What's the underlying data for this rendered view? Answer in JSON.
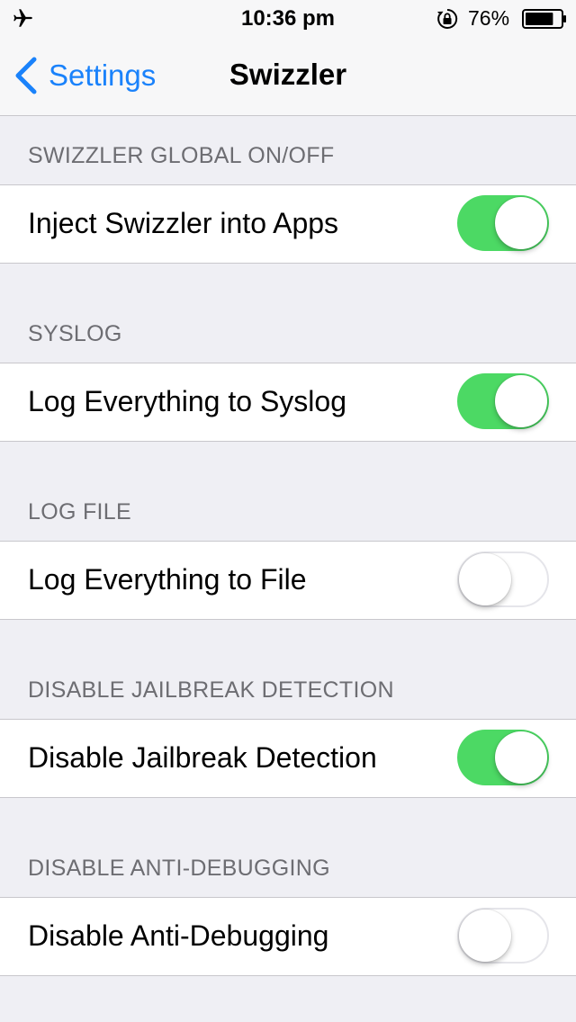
{
  "status_bar": {
    "time": "10:36 pm",
    "battery_percent": "76%",
    "battery_level": 0.76,
    "icons": [
      "airplane-icon",
      "orientation-lock-icon",
      "battery-icon"
    ]
  },
  "nav": {
    "back_label": "Settings",
    "title": "Swizzler",
    "accent_color": "#1a82fb"
  },
  "sections": [
    {
      "header": "SWIZZLER GLOBAL ON/OFF",
      "label": "Inject Swizzler into Apps",
      "on": true
    },
    {
      "header": "SYSLOG",
      "label": "Log Everything to Syslog",
      "on": true
    },
    {
      "header": "LOG FILE",
      "label": "Log Everything to File",
      "on": false
    },
    {
      "header": "DISABLE JAILBREAK DETECTION",
      "label": "Disable Jailbreak Detection",
      "on": true
    },
    {
      "header": "DISABLE ANTI-DEBUGGING",
      "label": "Disable Anti-Debugging",
      "on": false
    }
  ],
  "colors": {
    "toggle_on": "#4cd964",
    "background": "#efeff4",
    "header_text": "#6d6d72"
  }
}
